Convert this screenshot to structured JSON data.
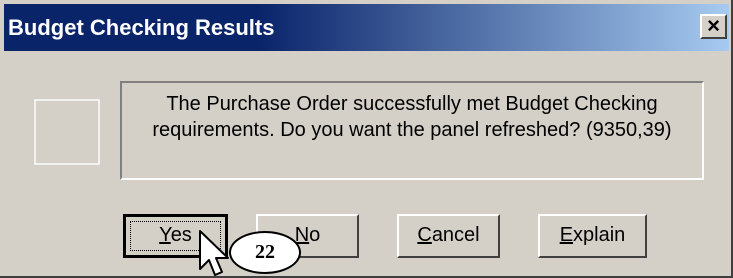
{
  "dialog": {
    "title": "Budget Checking Results",
    "close_label": "×",
    "message": {
      "line1": "The Purchase Order successfully met Budget Checking",
      "line2": "requirements. Do you want the panel refreshed? (9350,39)"
    },
    "buttons": {
      "yes": {
        "mnemonic": "Y",
        "rest": "es"
      },
      "no": {
        "mnemonic": "N",
        "rest": "o"
      },
      "cancel": {
        "mnemonic": "C",
        "rest": "ancel"
      },
      "explain": {
        "mnemonic": "E",
        "rest": "xplain"
      }
    }
  },
  "annotation": {
    "step_number": "22"
  },
  "colors": {
    "titlebar_dark": "#0a246a",
    "titlebar_light": "#a6caf0",
    "dialog_face": "#d4d0c8"
  }
}
